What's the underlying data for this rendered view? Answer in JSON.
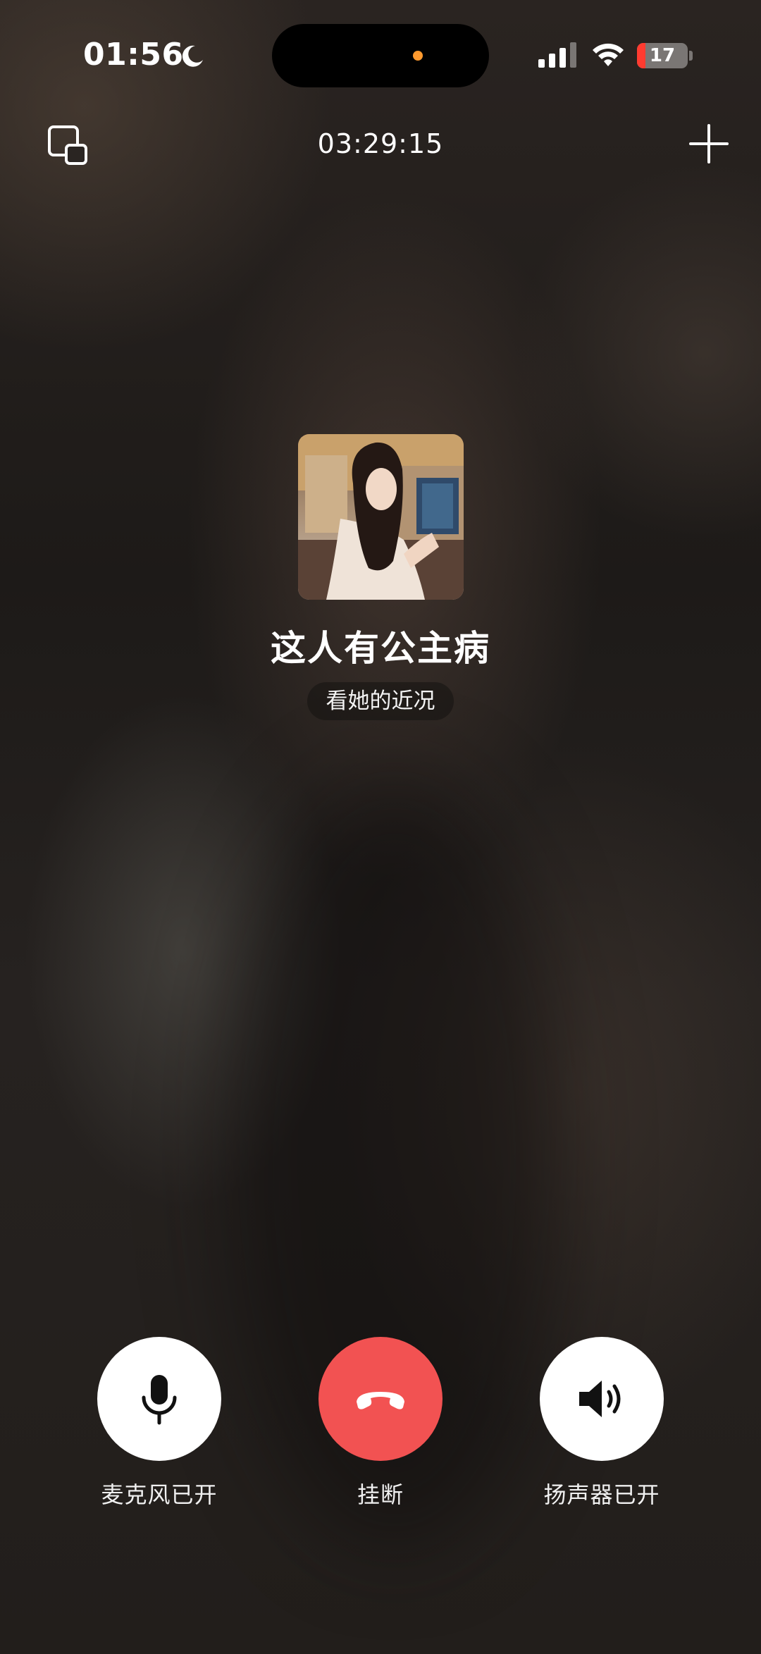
{
  "status_bar": {
    "time": "01:56",
    "focus_icon": "moon-icon",
    "signal_icon": "cellular-signal-icon",
    "wifi_icon": "wifi-icon",
    "battery_level": "17",
    "battery_fraction": 0.17,
    "battery_color": "#ff3b30"
  },
  "call": {
    "duration": "03:29:15",
    "minimize_icon": "floating-window-icon",
    "add_icon": "plus-icon"
  },
  "contact": {
    "name": "这人有公主病",
    "status": "看她的近况"
  },
  "controls": {
    "mic_label": "麦克风已开",
    "hangup_label": "挂断",
    "speaker_label": "扬声器已开",
    "mic_icon": "microphone-icon",
    "hangup_icon": "phone-hangup-icon",
    "speaker_icon": "speaker-icon",
    "hangup_color": "#f25252"
  }
}
